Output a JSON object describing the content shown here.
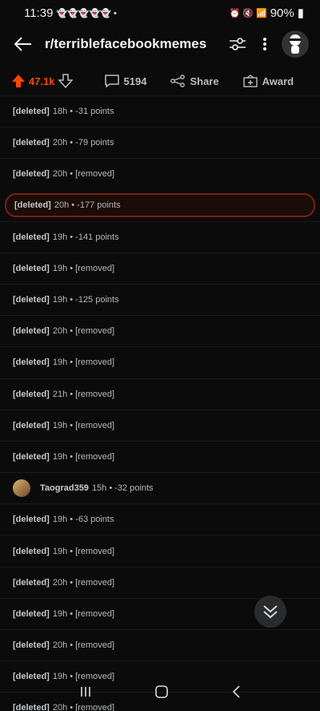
{
  "status": {
    "time": "11:39",
    "battery": "90%"
  },
  "header": {
    "subreddit": "r/terriblefacebookmemes"
  },
  "actions": {
    "votes": "47.1k",
    "comments": "5194",
    "share": "Share",
    "award": "Award"
  },
  "rows": [
    {
      "author": "[deleted]",
      "meta": "18h • -31 points"
    },
    {
      "author": "[deleted]",
      "meta": "20h • -79 points"
    },
    {
      "author": "[deleted]",
      "meta": "20h • [removed]"
    },
    {
      "author": "[deleted]",
      "meta": "20h • -177 points"
    },
    {
      "author": "[deleted]",
      "meta": "19h • -141 points"
    },
    {
      "author": "[deleted]",
      "meta": "19h • [removed]"
    },
    {
      "author": "[deleted]",
      "meta": "19h • -125 points"
    },
    {
      "author": "[deleted]",
      "meta": "20h • [removed]"
    },
    {
      "author": "[deleted]",
      "meta": "19h • [removed]"
    },
    {
      "author": "[deleted]",
      "meta": "21h • [removed]"
    },
    {
      "author": "[deleted]",
      "meta": "19h • [removed]"
    },
    {
      "author": "[deleted]",
      "meta": "19h • [removed]"
    },
    {
      "author": "Taograd359",
      "meta": "15h • -32 points"
    },
    {
      "author": "[deleted]",
      "meta": "19h • -63 points"
    },
    {
      "author": "[deleted]",
      "meta": "19h • [removed]"
    },
    {
      "author": "[deleted]",
      "meta": "20h • [removed]"
    },
    {
      "author": "[deleted]",
      "meta": "19h • [removed]"
    },
    {
      "author": "[deleted]",
      "meta": "20h • [removed]"
    },
    {
      "author": "[deleted]",
      "meta": "19h • [removed]"
    },
    {
      "author": "[deleted]",
      "meta": "20h • [removed]"
    }
  ],
  "colors": {
    "upvote": "#ff4500",
    "highlight_border": "#7a1f12"
  }
}
